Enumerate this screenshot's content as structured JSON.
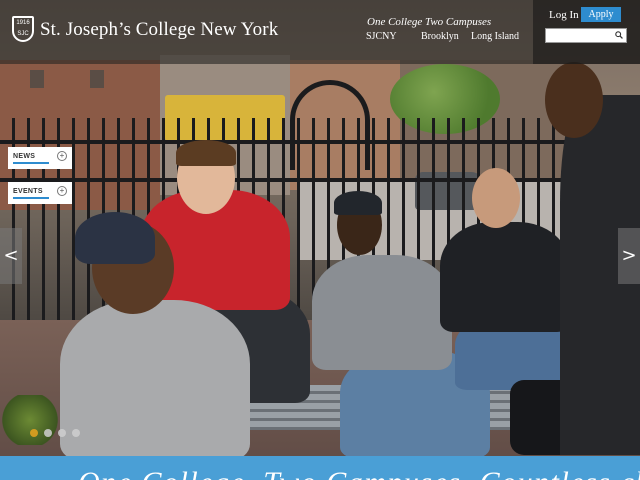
{
  "header": {
    "logo_name": "St. Joseph’s College New York",
    "logo_shield_text": "SJC",
    "logo_shield_year": "1916",
    "tagline": "One College  Two Campuses",
    "campus_links": [
      "SJCNY",
      "Brooklyn",
      "Long Island"
    ]
  },
  "utility": {
    "login_label": "Log In",
    "apply_label": "Apply",
    "search_placeholder": ""
  },
  "side_tabs": [
    {
      "label": "NEWS"
    },
    {
      "label": "EVENTS"
    }
  ],
  "carousel": {
    "prev_glyph": "<",
    "next_glyph": ">",
    "slide_count": 4,
    "active_slide": 1
  },
  "banner": {
    "text": "One College. Two Campuses. Countless choices."
  },
  "colors": {
    "accent_blue": "#2e8ccf",
    "banner_blue": "#4a9fd6",
    "dot_active": "#e7a31f"
  }
}
